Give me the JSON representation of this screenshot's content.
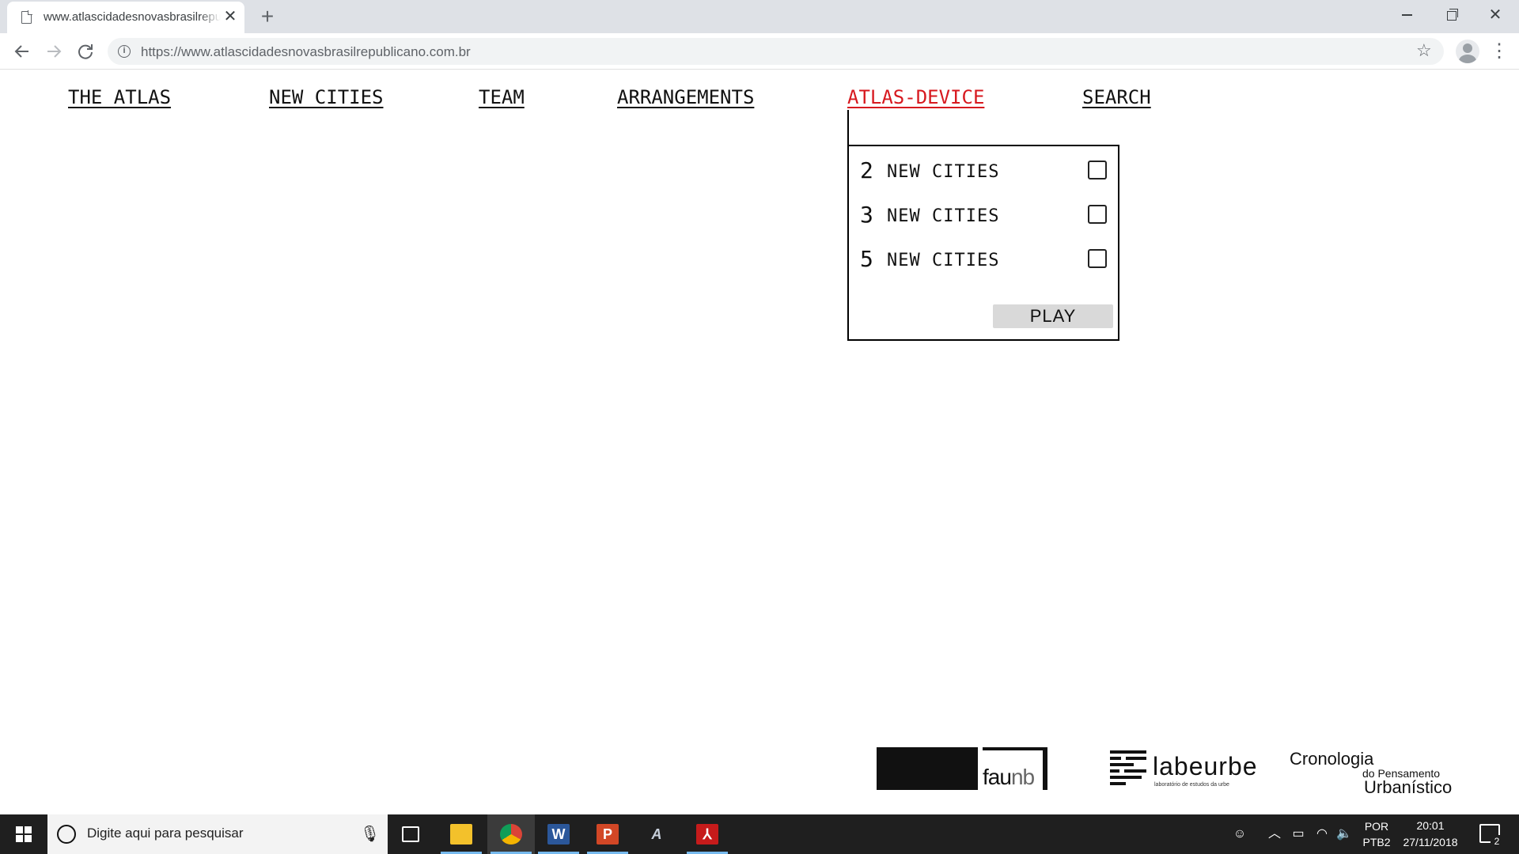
{
  "browser": {
    "tab_title": "www.atlascidadesnovasbrasilrepublicano.com.br",
    "tab_close": "✕",
    "new_tab": "+",
    "url": "https://www.atlascidadesnovasbrasilrepublicano.com.br",
    "star": "☆",
    "menu": "⋮"
  },
  "nav": {
    "items": [
      {
        "label": "THE ATLAS"
      },
      {
        "label": "NEW CITIES"
      },
      {
        "label": "TEAM"
      },
      {
        "label": "ARRANGEMENTS"
      },
      {
        "label": "ATLAS-DEVICE",
        "active": true
      },
      {
        "label": "SEARCH"
      }
    ]
  },
  "device_panel": {
    "options": [
      {
        "number": "2",
        "label": "NEW CITIES",
        "checked": false
      },
      {
        "number": "3",
        "label": "NEW CITIES",
        "checked": false
      },
      {
        "number": "5",
        "label": "NEW CITIES",
        "checked": false
      }
    ],
    "play_label": "PLAY"
  },
  "colors": {
    "active_nav": "#d7191f",
    "text": "#111111",
    "play_button": "#d9d9d9",
    "taskbar": "#1f1f1f"
  },
  "footer": {
    "logos": {
      "faunb": {
        "fau": "fau",
        "nb": "nb"
      },
      "labeurbe": {
        "word": "labeurbe",
        "tagline": "laboratório de estudos da urbe"
      },
      "cronologia": {
        "line1": "Cronologia",
        "line2": "do Pensamento",
        "line3": "Urbanístico"
      }
    }
  },
  "taskbar": {
    "search_placeholder": "Digite aqui para pesquisar",
    "apps": [
      {
        "name": "file-explorer",
        "glyph": "▬"
      },
      {
        "name": "chrome",
        "glyph": "●"
      },
      {
        "name": "word",
        "glyph": "W"
      },
      {
        "name": "powerpoint",
        "glyph": "P"
      },
      {
        "name": "autocad",
        "glyph": "A"
      },
      {
        "name": "acrobat",
        "glyph": "⅄"
      }
    ],
    "language_top": "POR",
    "language_bottom": "PTB2",
    "time": "20:01",
    "date": "27/11/2018",
    "notification_count": "2"
  }
}
